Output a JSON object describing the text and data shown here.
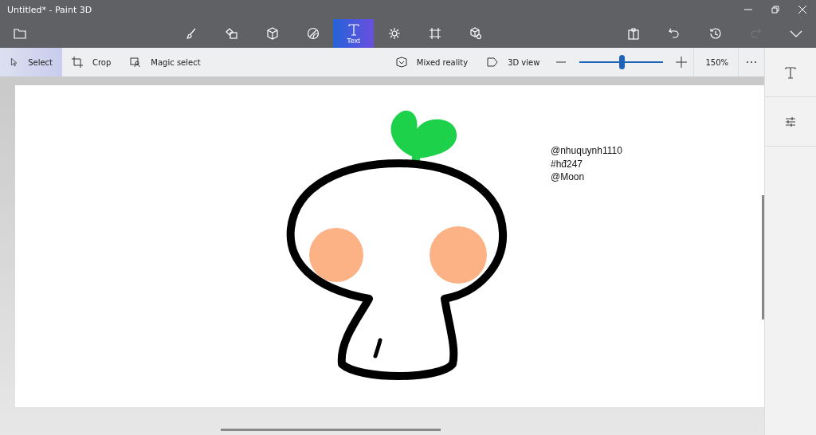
{
  "window": {
    "title": "Untitled* - Paint 3D"
  },
  "tools": [
    {
      "kind": "brushes",
      "selected": false
    },
    {
      "kind": "shapes2d",
      "selected": false
    },
    {
      "kind": "shapes3d",
      "selected": false
    },
    {
      "kind": "stickers",
      "selected": false
    },
    {
      "kind": "text",
      "label": "Text",
      "selected": true
    },
    {
      "kind": "effects",
      "selected": false
    },
    {
      "kind": "canvas",
      "selected": false
    },
    {
      "kind": "library",
      "selected": false
    }
  ],
  "actions": [
    {
      "kind": "paste",
      "disabled": false
    },
    {
      "kind": "undo",
      "disabled": false
    },
    {
      "kind": "history",
      "disabled": false
    },
    {
      "kind": "redo",
      "disabled": true
    },
    {
      "kind": "expand",
      "disabled": false
    }
  ],
  "toolbar": {
    "left": [
      {
        "kind": "select",
        "label": "Select",
        "selected": true
      },
      {
        "kind": "crop",
        "label": "Crop",
        "selected": false
      },
      {
        "kind": "magic",
        "label": "Magic select",
        "selected": false
      }
    ],
    "right": [
      {
        "kind": "mixed",
        "label": "Mixed reality"
      },
      {
        "kind": "view3d",
        "label": "3D view"
      }
    ],
    "zoom": {
      "level": 0.51,
      "reading": "150%"
    }
  },
  "canvas": {
    "lines": [
      "@nhuquynh1110",
      "#hđ247",
      "@Moon"
    ]
  },
  "side_panel": [
    {
      "kind": "text"
    },
    {
      "kind": "adjust"
    }
  ]
}
